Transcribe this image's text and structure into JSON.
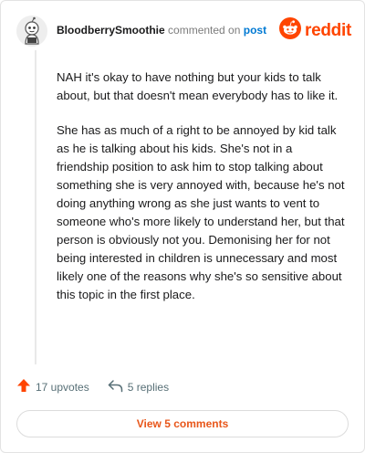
{
  "header": {
    "username": "BloodberrySmoothie",
    "commented_text": "commented on",
    "post_link": "post",
    "brand": "reddit",
    "avatar_icon": "snoo-avatar-icon",
    "logo_icon": "reddit-snoo-icon"
  },
  "comment": {
    "paragraphs": [
      "NAH it's okay to have nothing but your kids to talk about, but that doesn't mean everybody has to like it.",
      "She has as much of a right to be annoyed by kid talk as he is talking about his kids. She's not in a friendship position to ask him to stop talking about something she is very annoyed with, because he's not doing anything wrong as she just wants to vent to someone who's more likely to understand her, but that person is obviously not you. Demonising her for not being interested in children is unnecessary and most likely one of the reasons why she's so sensitive about this topic in the first place."
    ]
  },
  "actions": {
    "upvotes": "17 upvotes",
    "replies": "5 replies",
    "upvote_icon": "upvote-arrow-icon",
    "reply_icon": "reply-arrow-icon"
  },
  "footer": {
    "view_button": "View 5 comments"
  },
  "colors": {
    "brand": "#ff4500",
    "link": "#0079d3",
    "button_text": "#e8561a",
    "muted": "#7c7c7c"
  }
}
